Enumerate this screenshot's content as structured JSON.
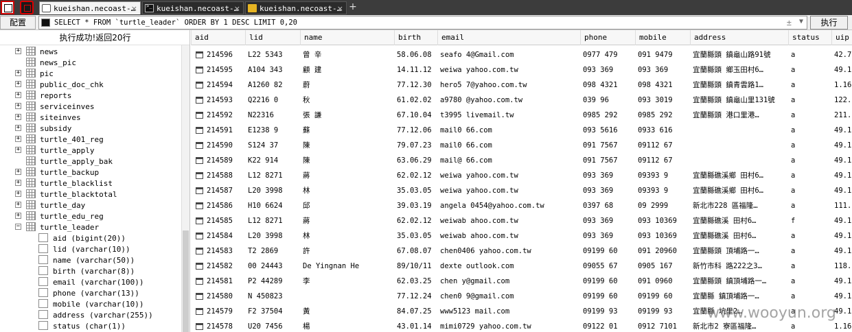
{
  "tabs": [
    {
      "label": "kueishan.necoast-…",
      "close": "×"
    },
    {
      "label": "kueishan.necoast-…",
      "close": "×"
    },
    {
      "label": "kueishan.necoast-…",
      "close": "×"
    }
  ],
  "tab_add": "+",
  "toolbar": {
    "config_label": "配置",
    "query": "SELECT * FROM `turtle_leader` ORDER BY 1 DESC LIMIT 0,20",
    "clear_glyph": "±",
    "dropdown_glyph": "▼",
    "execute_label": "执行"
  },
  "sidebar": {
    "status": "执行成功!返回20行",
    "tables": [
      {
        "name": "news",
        "expander": "+"
      },
      {
        "name": "news_pic",
        "expander": ""
      },
      {
        "name": "pic",
        "expander": "+"
      },
      {
        "name": "public_doc_chk",
        "expander": "+"
      },
      {
        "name": "reports",
        "expander": "+"
      },
      {
        "name": "serviceinves",
        "expander": "+"
      },
      {
        "name": "siteinves",
        "expander": "+"
      },
      {
        "name": "subsidy",
        "expander": "+"
      },
      {
        "name": "turtle_401_reg",
        "expander": "+"
      },
      {
        "name": "turtle_apply",
        "expander": "+"
      },
      {
        "name": "turtle_apply_bak",
        "expander": ""
      },
      {
        "name": "turtle_backup",
        "expander": "+"
      },
      {
        "name": "turtle_blacklist",
        "expander": "+"
      },
      {
        "name": "turtle_blacktotal",
        "expander": "+"
      },
      {
        "name": "turtle_day",
        "expander": "+"
      },
      {
        "name": "turtle_edu_reg",
        "expander": "+"
      },
      {
        "name": "turtle_leader",
        "expander": "−"
      }
    ],
    "columns": [
      "aid (bigint(20))",
      "lid (varchar(10))",
      "name (varchar(50))",
      "birth (varchar(8))",
      "email (varchar(100))",
      "phone (varchar(13))",
      "mobile (varchar(10))",
      "address (varchar(255))",
      "status (char(1))"
    ]
  },
  "grid": {
    "headers": [
      "aid",
      "lid",
      "name",
      "birth",
      "email",
      "phone",
      "mobile",
      "address",
      "status",
      "uip"
    ],
    "rows": [
      [
        "214596",
        "L22  5343",
        "曾  辛",
        "58.06.08",
        "seafo    4@Gmail.com",
        "0977  479",
        "091  9479",
        "宜蘭縣頭  鎮龜山路91號",
        "a",
        "42.7"
      ],
      [
        "214595",
        "A104  343",
        "顧  建",
        "14.11.12",
        "weiwa   yahoo.com.tw",
        "093   369",
        "093   369",
        "宜蘭縣頭   鄉玉田村6…",
        "a",
        "49.1"
      ],
      [
        "214594",
        "A1260  82",
        "    蔚",
        "77.12.30",
        "hero5  7@yahoo.com.tw",
        "098  4321",
        "098  4321",
        "宜蘭縣頭  鎮青雲路1…",
        "a",
        "1.16"
      ],
      [
        "214593",
        "Q2216  0",
        "    秋",
        "61.02.02",
        "a9780  @yahoo.com.tw",
        "039   96",
        "093  3019",
        "宜蘭縣頭  鎮龜山里131號",
        "a",
        "122."
      ],
      [
        "214592",
        "N22316  ",
        "張  謙",
        "67.10.04",
        "t3995  livemail.tw",
        "0985  292",
        "0985  292",
        "宜蘭縣頭  港口里港…",
        "a",
        "211."
      ],
      [
        "214591",
        "E1238  9",
        "蘇  ",
        "77.12.06",
        "mail0   66.com",
        "093  5616",
        "0933  616",
        "",
        "a",
        "49.1"
      ],
      [
        "214590",
        "S124  37",
        "陳  ",
        "79.07.23",
        "mail0   66.com",
        "091  7567",
        "09112  67",
        "",
        "a",
        "49.1"
      ],
      [
        "214589",
        "K22  914",
        "陳  ",
        "63.06.29",
        "mail@   66.com",
        "091  7567",
        "09112  67",
        "",
        "a",
        "49.1"
      ],
      [
        "214588",
        "L12  8271",
        "蔣  ",
        "62.02.12",
        "weiwa   yahoo.com.tw",
        "093   369",
        "09393  9",
        "宜蘭縣礁溪鄉  田村6…",
        "a",
        "49.1"
      ],
      [
        "214587",
        "L20  3998",
        "林  ",
        "35.03.05",
        "weiwa   yahoo.com.tw",
        "093   369",
        "09393  9",
        "宜蘭縣礁溪鄉  田村6…",
        "a",
        "49.1"
      ],
      [
        "214586",
        "H10  6624",
        "邱  ",
        "39.03.19",
        "angela  0454@yahoo.com.tw",
        "0397   68",
        "09   2999",
        "新北市228  區福隆…",
        "a",
        "111."
      ],
      [
        "214585",
        "L12  8271",
        "蔣  ",
        "62.02.12",
        "weiwab   ahoo.com.tw",
        "093   369",
        "093  10369",
        "宜蘭縣礁溪  田村6…",
        "f",
        "49.1"
      ],
      [
        "214584",
        "L20  3998",
        "林  ",
        "35.03.05",
        "weiwab   ahoo.com.tw",
        "093   369",
        "093  10369",
        "宜蘭縣礁溪  田村6…",
        "a",
        "49.1"
      ],
      [
        "214583",
        "T2  2869",
        "許  ",
        "67.08.07",
        "chen0406  yahoo.com.tw",
        "09199  60",
        "091  20960",
        "宜蘭縣頭  頂埔路一…",
        "a",
        "49.1"
      ],
      [
        "214582",
        "00  24443",
        "De   Yingnan He",
        "89/10/11",
        "dexte   outlook.com",
        "09055   67",
        "0905  167",
        "新竹市科   路222之3…",
        "a",
        "118."
      ],
      [
        "214581",
        "P2  44289",
        "李  ",
        "62.03.25",
        "chen   y@gmail.com",
        "09199  60",
        "091   0960",
        "宜蘭縣頭  鎮頂埔路一…",
        "a",
        "49.1"
      ],
      [
        "214580",
        "N  450823",
        "    ",
        "77.12.24",
        "chen0   9@gmail.com",
        "09199  60",
        "09199  60",
        "宜蘭縣  鎮頂埔路一…",
        "a",
        "49.1"
      ],
      [
        "214579",
        "F2  37504",
        "黃  ",
        "84.07.25",
        "www5123   mail.com",
        "09199  93",
        "09199  93",
        "宜蘭縣  坑里2…",
        "a",
        "49.1"
      ],
      [
        "214578",
        "U20  7456",
        "楊  ",
        "43.01.14",
        "mimi0729  yahoo.com.tw",
        "09122  01",
        "0912  7101",
        "新北市2  寮區福隆…",
        "a",
        "1.16"
      ]
    ]
  },
  "watermark": "www.wooyun.org",
  "colors": {
    "tab_dark": "#2b2b2b",
    "tab_active": "#f4f4f4",
    "accent_red": "#cc0000"
  }
}
